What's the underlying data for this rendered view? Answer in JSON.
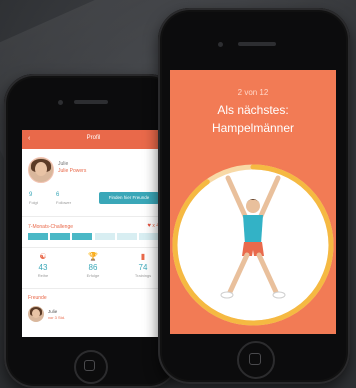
{
  "profile_screen": {
    "header_title": "Profil",
    "user_first": "Julie",
    "user_full": "Julie Powers",
    "stats": [
      {
        "value": "9",
        "label": "Folgt"
      },
      {
        "value": "6",
        "label": "Follower"
      }
    ],
    "find_friends_button": "Finden hier Freunde",
    "challenge_label": "7-Monats-Challenge",
    "challenge_count": "x 4",
    "challenge_progress": {
      "done": 3,
      "total": 6
    },
    "metrics": [
      {
        "icon": "hiit-icon",
        "value": "43",
        "label": "Reihe"
      },
      {
        "icon": "trophy-icon",
        "value": "86",
        "label": "Erfolge"
      },
      {
        "icon": "bars-icon",
        "value": "74",
        "label": "Trainings"
      }
    ],
    "section_label": "Freunde",
    "friend_name": "Julie",
    "friend_sub": "vor 3 Std."
  },
  "exercise_screen": {
    "progress_text": "2 von 12",
    "title_line1": "Als nächstes:",
    "title_line2": "Hampelmänner",
    "timer_fraction": 0.9
  },
  "colors": {
    "accent": "#e9694a",
    "teal": "#3aa7b8",
    "exercise_bg": "#f27b55",
    "ring": "#f5b942"
  }
}
